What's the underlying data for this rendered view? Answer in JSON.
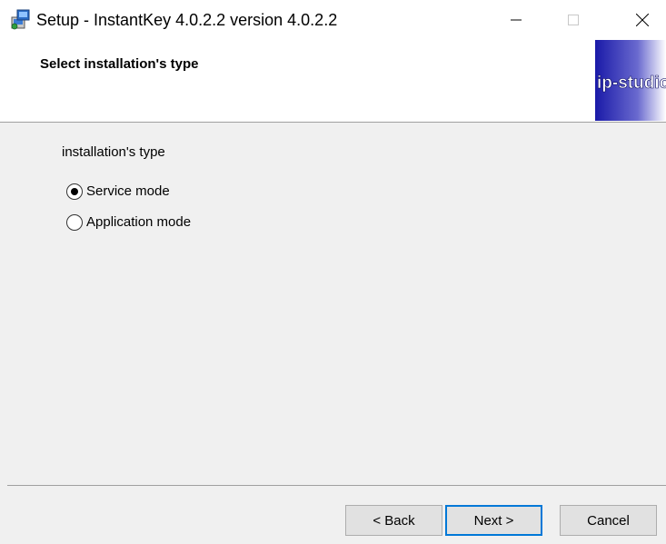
{
  "window": {
    "title": "Setup - InstantKey 4.0.2.2 version 4.0.2.2",
    "icon": "setup-installer-icon",
    "controls": [
      "minimize-icon",
      "maximize-icon",
      "close-icon"
    ]
  },
  "header": {
    "title": "Select installation's type",
    "logo_text": "ip-studio"
  },
  "body": {
    "group_label": "installation's type",
    "options": [
      {
        "label": "Service mode",
        "selected": true
      },
      {
        "label": "Application mode",
        "selected": false
      }
    ]
  },
  "footer": {
    "back_label": "< Back",
    "next_label": "Next >",
    "cancel_label": "Cancel"
  },
  "colors": {
    "focus_border": "#0078d7",
    "logo_dark": "#1a1aa8",
    "logo_light": "#ffffff"
  }
}
